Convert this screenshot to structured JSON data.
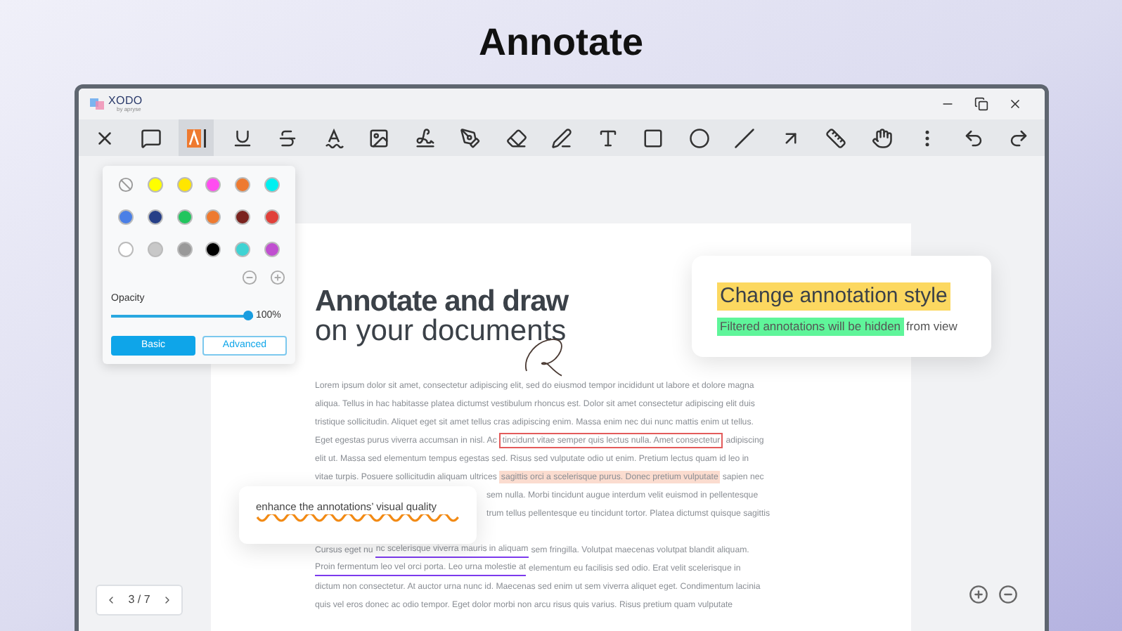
{
  "headline": "Annotate",
  "app": {
    "logo": "XODO",
    "logo_sub": "by apryse"
  },
  "tools": [
    {
      "kind": "close",
      "selected": false
    },
    {
      "kind": "comment",
      "selected": false
    },
    {
      "kind": "highlight",
      "selected": true
    },
    {
      "kind": "underline",
      "selected": false
    },
    {
      "kind": "strikeout",
      "selected": false
    },
    {
      "kind": "squiggly",
      "selected": false
    },
    {
      "kind": "image",
      "selected": false
    },
    {
      "kind": "signature",
      "selected": false
    },
    {
      "kind": "pen",
      "selected": false
    },
    {
      "kind": "eraser",
      "selected": false
    },
    {
      "kind": "marker",
      "selected": false
    },
    {
      "kind": "text",
      "selected": false
    },
    {
      "kind": "rectangle",
      "selected": false
    },
    {
      "kind": "ellipse",
      "selected": false
    },
    {
      "kind": "line",
      "selected": false
    },
    {
      "kind": "arrow",
      "selected": false
    },
    {
      "kind": "ruler",
      "selected": false
    },
    {
      "kind": "pan",
      "selected": false
    },
    {
      "kind": "more",
      "selected": false
    },
    {
      "kind": "undo",
      "selected": false
    },
    {
      "kind": "redo",
      "selected": false
    }
  ],
  "style_popover": {
    "swatches": [
      {
        "kind": "none"
      },
      {
        "kind": "color",
        "color": "#ffff00"
      },
      {
        "kind": "color",
        "color": "#ffe600"
      },
      {
        "kind": "color",
        "color": "#ff4df0"
      },
      {
        "kind": "color",
        "color": "#ee7a30"
      },
      {
        "kind": "color",
        "color": "#00f0f0"
      },
      {
        "kind": "color",
        "color": "#4a7fe6"
      },
      {
        "kind": "color",
        "color": "#263f87"
      },
      {
        "kind": "color",
        "color": "#22c55e"
      },
      {
        "kind": "color",
        "color": "#ee7a30"
      },
      {
        "kind": "color",
        "color": "#7a231f"
      },
      {
        "kind": "color",
        "color": "#e0403a"
      },
      {
        "kind": "color",
        "color": "#ffffff"
      },
      {
        "kind": "color",
        "color": "#c8c8c8"
      },
      {
        "kind": "color",
        "color": "#999999"
      },
      {
        "kind": "color",
        "color": "#000000"
      },
      {
        "kind": "color",
        "color": "#3fd3d3"
      },
      {
        "kind": "color",
        "color": "#c04fd0"
      }
    ],
    "opacity": {
      "label": "Opacity",
      "level": 1,
      "reading": "100%"
    },
    "modes": [
      {
        "label": "Basic",
        "selected": true
      },
      {
        "label": "Advanced",
        "selected": false
      }
    ]
  },
  "document": {
    "title_bold": "Annotate and draw",
    "title_light": "on your documents",
    "paragraphs": [
      [
        {
          "kind": "full",
          "segments": [
            {
              "kind": "plain",
              "text": "Lorem ipsum dolor sit amet, consectetur adipiscing elit, sed do eiusmod tempor incididunt ut labore et dolore magna"
            }
          ]
        },
        {
          "kind": "full",
          "segments": [
            {
              "kind": "plain",
              "text": "aliqua. Tellus in hac habitasse platea dictumst vestibulum rhoncus est. Dolor sit amet consectetur adipiscing elit duis"
            }
          ]
        },
        {
          "kind": "full",
          "segments": [
            {
              "kind": "plain",
              "text": "tristique sollicitudin. Aliquet eget sit amet tellus cras adipiscing enim. Massa enim nec dui nunc mattis enim ut tellus."
            }
          ]
        },
        {
          "kind": "full",
          "segments": [
            {
              "kind": "plain",
              "text": "Eget egestas purus viverra accumsan in nisl. Ac"
            },
            {
              "kind": "boxed",
              "text": "tincidunt vitae semper quis lectus nulla. Amet consectetur"
            },
            {
              "kind": "plain",
              "text": "adipiscing"
            }
          ]
        },
        {
          "kind": "full",
          "segments": [
            {
              "kind": "plain",
              "text": "elit ut. Massa sed elementum tempus egestas sed. Risus sed vulputate odio ut enim. Pretium lectus quam id leo in"
            }
          ]
        },
        {
          "kind": "full",
          "segments": [
            {
              "kind": "plain",
              "text": "vitae turpis. Posuere sollicitudin aliquam ultrices"
            },
            {
              "kind": "highlight",
              "text": "sagittis orci a scelerisque purus. Donec pretium vulputate"
            },
            {
              "kind": "plain",
              "text": "sapien nec"
            }
          ]
        },
        {
          "kind": "covered",
          "segments": [
            {
              "kind": "plain",
              "text": "sem nulla. Morbi tincidunt augue interdum velit euismod in pellentesque"
            }
          ]
        },
        {
          "kind": "covered",
          "segments": [
            {
              "kind": "plain",
              "text": "trum tellus pellentesque eu tincidunt tortor. Platea dictumst quisque sagittis"
            }
          ]
        }
      ],
      [
        {
          "kind": "full",
          "segments": [
            {
              "kind": "plain",
              "text": "Cursus eget nu"
            },
            {
              "kind": "underline",
              "text": "nc scelerisque viverra mauris in aliquam"
            },
            {
              "kind": "plain",
              "text": "sem fringilla. Volutpat maecenas volutpat blandit aliquam."
            }
          ]
        },
        {
          "kind": "full",
          "segments": [
            {
              "kind": "underline",
              "text": "Proin fermentum leo vel orci porta. Leo urna molestie at"
            },
            {
              "kind": "plain",
              "text": "elementum eu facilisis sed odio. Erat velit scelerisque in"
            }
          ]
        },
        {
          "kind": "full",
          "segments": [
            {
              "kind": "plain",
              "text": "dictum non consectetur. At auctor urna nunc id. Maecenas sed enim ut sem viverra aliquet eget. Condimentum lacinia"
            }
          ]
        },
        {
          "kind": "full",
          "segments": [
            {
              "kind": "plain",
              "text": "quis vel eros donec ac odio tempor. Eget dolor morbi non arcu risus quis varius. Risus pretium quam vulputate"
            }
          ]
        }
      ]
    ]
  },
  "style_callout": {
    "title": "Change annotation style",
    "note_highlighted": "Filtered annotations will be hidden",
    "note_rest": "from view"
  },
  "quality_callout": {
    "text": "enhance the annotations’ visual quality"
  },
  "page_nav": {
    "page": "3 / 7"
  }
}
